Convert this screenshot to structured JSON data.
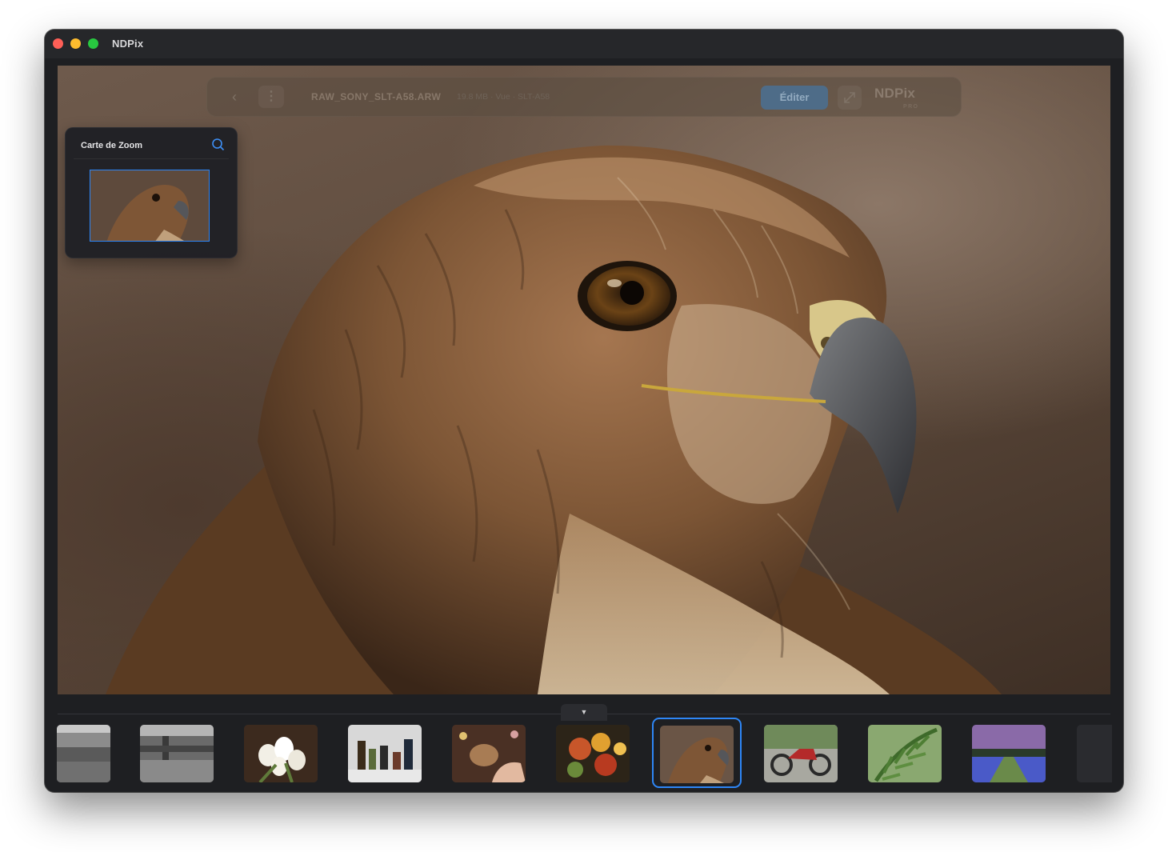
{
  "app": {
    "title": "NDPix"
  },
  "toolbar": {
    "filename": "RAW_SONY_SLT-A58.ARW",
    "meta": "19.8 MB · Vue · SLT-A58",
    "edit_label": "Éditer",
    "logo": "NDPix",
    "logo_tier": "PRO"
  },
  "zoom_map": {
    "title": "Carte de Zoom"
  },
  "filmstrip": {
    "toggle_icon": "▼",
    "thumbnails": [
      {
        "subject": "harbor-grayscale"
      },
      {
        "subject": "pier-grayscale"
      },
      {
        "subject": "white-tulips"
      },
      {
        "subject": "bottles-shelf"
      },
      {
        "subject": "hamster-in-hand"
      },
      {
        "subject": "autumn-leaves"
      },
      {
        "subject": "hawk-portrait",
        "selected": true
      },
      {
        "subject": "red-motorcycle"
      },
      {
        "subject": "fern-leaves"
      },
      {
        "subject": "purple-flower-field"
      }
    ]
  },
  "colors": {
    "accent": "#2e86f6",
    "window_bg": "#1e1f22",
    "titlebar_bg": "#26272a"
  }
}
